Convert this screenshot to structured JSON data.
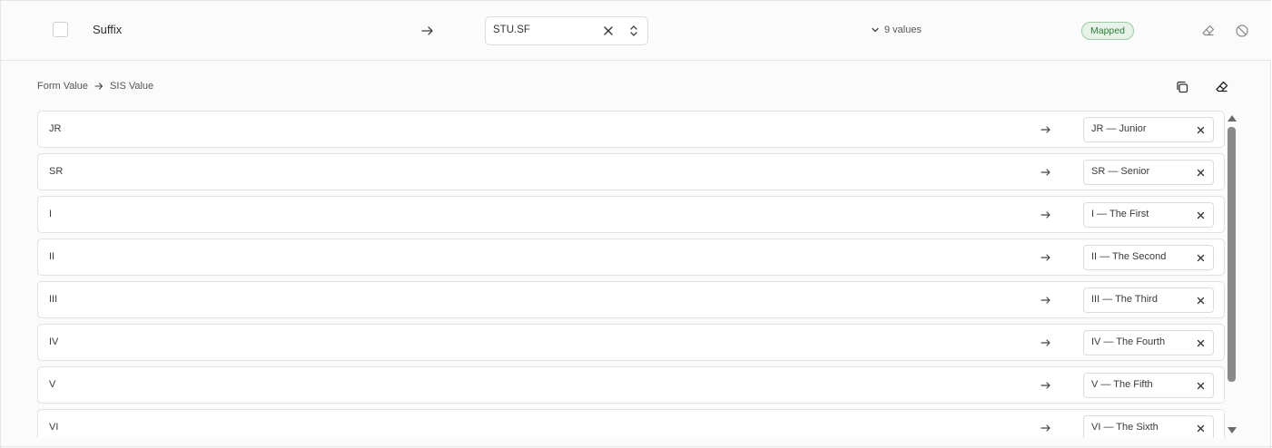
{
  "field_row": {
    "name": "Suffix",
    "select_value": "STU.SF",
    "values_toggle": "9 values",
    "status": "Mapped",
    "status_color": "#2e7d3a"
  },
  "panel": {
    "col_from": "Form Value",
    "col_to": "SIS Value"
  },
  "mappings": [
    {
      "key": "JR",
      "value": "JR — Junior"
    },
    {
      "key": "SR",
      "value": "SR — Senior"
    },
    {
      "key": "I",
      "value": "I — The First"
    },
    {
      "key": "II",
      "value": "II — The Second"
    },
    {
      "key": "III",
      "value": "III — The Third"
    },
    {
      "key": "IV",
      "value": "IV — The Fourth"
    },
    {
      "key": "V",
      "value": "V — The Fifth"
    },
    {
      "key": "VI",
      "value": "VI — The Sixth"
    }
  ]
}
